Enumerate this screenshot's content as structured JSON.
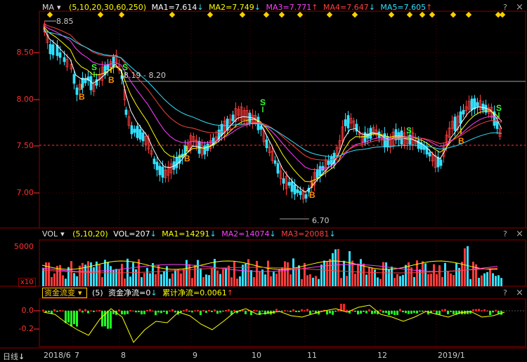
{
  "main_header": {
    "indicator": "MA",
    "params": "(5,10,20,30,60,250)",
    "ma1": "MA1=7.614",
    "ma2": "MA2=7.749",
    "ma3": "MA3=7.771",
    "ma4": "MA4=7.647",
    "ma5": "MA5=7.605",
    "arrow_down": "↓",
    "arrow_up": "↑"
  },
  "price_axis": [
    "8.50",
    "8.00",
    "7.50",
    "7.00"
  ],
  "price_annotations": {
    "high": "8.85",
    "low": "6.70",
    "range": "8.19 - 8.20"
  },
  "signals": {
    "buy": "B",
    "sell": "S"
  },
  "vol_header": {
    "indicator": "VOL",
    "params": "(5,10,20)",
    "vol": "VOL=207",
    "ma1": "MA1=14291",
    "ma2": "MA2=14074",
    "ma3": "MA3=20081"
  },
  "vol_axis": {
    "top": "5000",
    "unit": "x10"
  },
  "flow_header": {
    "indicator": "资金流变",
    "params": "(5)",
    "net": "资金净流=0",
    "cum": "累计净流=0.0061"
  },
  "flow_axis": [
    "0.0",
    "-0.2"
  ],
  "x_axis": {
    "period": "日线",
    "labels": [
      "2018/6",
      "7",
      "8",
      "9",
      "10",
      "11",
      "12",
      "2019/1"
    ]
  },
  "controls": {
    "help": "?",
    "close": "×"
  },
  "colors": {
    "up": "#ff3c3c",
    "down": "#33e0ff",
    "ma1": "#ffffff",
    "ma2": "#ffff00",
    "ma3": "#ff40ff",
    "ma4": "#ff4040",
    "ma5": "#33e0ff",
    "axis": "#ff3030"
  }
}
